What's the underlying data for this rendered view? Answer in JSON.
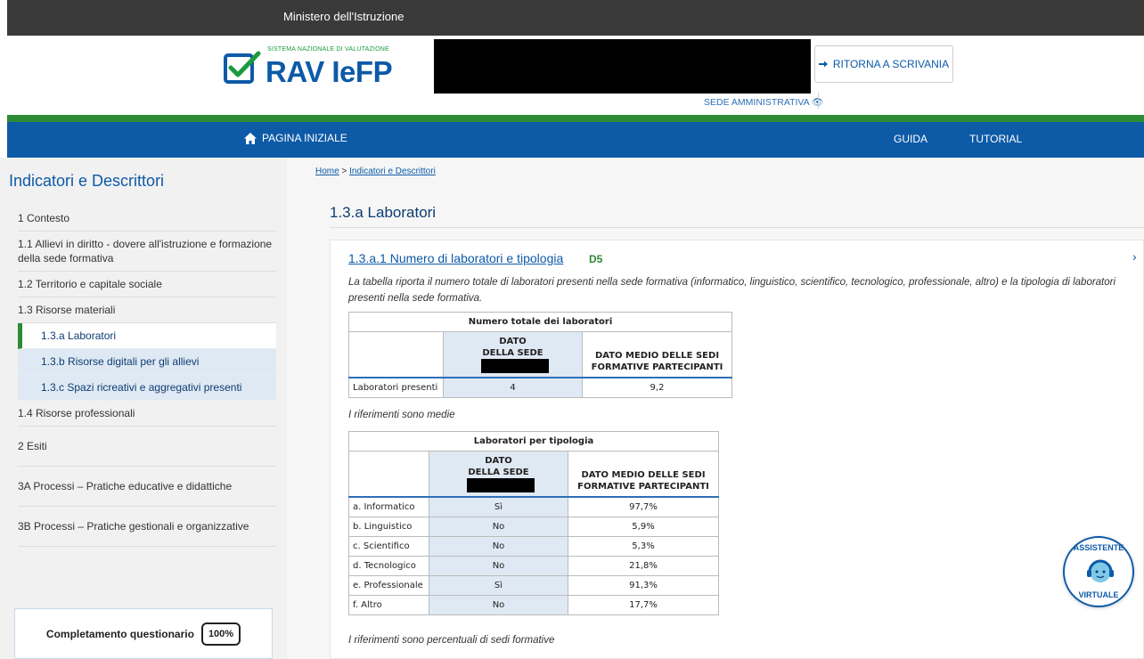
{
  "topbar": {
    "text": "Ministero dell'Istruzione"
  },
  "header": {
    "logo_sub": "SISTEMA NAZIONALE DI VALUTAZIONE",
    "logo_title": "RAV IeFP",
    "sede_link": "SEDE AMMINISTRATIVA",
    "scrivania_button": "RITORNA A SCRIVANIA"
  },
  "nav": {
    "home": "PAGINA INIZIALE",
    "guida": "GUIDA",
    "tutorial": "TUTORIAL"
  },
  "sidebar": {
    "title": "Indicatori e Descrittori",
    "items": [
      {
        "label": "1 Contesto"
      },
      {
        "label": "1.1 Allievi in diritto - dovere all'istruzione e formazione della sede formativa"
      },
      {
        "label": "1.2 Territorio e capitale sociale"
      },
      {
        "label": "1.3 Risorse materiali"
      },
      {
        "label": "1.3.a Laboratori"
      },
      {
        "label": "1.3.b Risorse digitali per gli allievi"
      },
      {
        "label": "1.3.c Spazi ricreativi e aggregativi presenti"
      },
      {
        "label": "1.4 Risorse professionali"
      },
      {
        "label": "2 Esiti"
      },
      {
        "label": "3A Processi – Pratiche educative e didattiche"
      },
      {
        "label": "3B Processi – Pratiche gestionali e organizzative"
      }
    ],
    "completamento_label": "Completamento questionario",
    "completamento_value": "100%"
  },
  "breadcrumb": {
    "home": "Home",
    "sep": ">",
    "current": "Indicatori e Descrittori"
  },
  "main": {
    "title": "1.3.a Laboratori",
    "card_title": "1.3.a.1 Numero di laboratori e tipologia",
    "card_badge": "D5",
    "card_description": "La tabella riporta il numero totale di laboratori presenti nella sede formativa (informatico, linguistico, scientifico, tecnologico, professionale, altro) e la tipologia di laboratori presenti nella sede formativa.",
    "table1": {
      "caption": "Numero totale dei laboratori",
      "col_sede_1": "DATO",
      "col_sede_2": "DELLA SEDE",
      "col_medio_1": "DATO MEDIO DELLE SEDI",
      "col_medio_2": "FORMATIVE PARTECIPANTI",
      "row_label": "Laboratori presenti",
      "row_sede": "4",
      "row_medio": "9,2"
    },
    "note1": "I riferimenti sono medie",
    "table2": {
      "caption": "Laboratori per tipologia",
      "col_sede_1": "DATO",
      "col_sede_2": "DELLA SEDE",
      "col_medio_1": "DATO MEDIO DELLE SEDI",
      "col_medio_2": "FORMATIVE PARTECIPANTI",
      "rows": [
        {
          "label": "a. Informatico",
          "sede": "Sì",
          "medio": "97,7%"
        },
        {
          "label": "b. Linguistico",
          "sede": "No",
          "medio": "5,9%"
        },
        {
          "label": "c. Scientifico",
          "sede": "No",
          "medio": "5,3%"
        },
        {
          "label": "d. Tecnologico",
          "sede": "No",
          "medio": "21,8%"
        },
        {
          "label": "e. Professionale",
          "sede": "Sì",
          "medio": "91,3%"
        },
        {
          "label": "f. Altro",
          "sede": "No",
          "medio": "17,7%"
        }
      ]
    },
    "note2": "I riferimenti sono percentuali di sedi formative"
  },
  "assistant": {
    "top": "ASSISTENTE",
    "bottom": "VIRTUALE"
  },
  "icons": {
    "home": "home-icon",
    "login": "sign-in-icon",
    "eye": "eye-icon",
    "chevron": "chevron-right-icon"
  },
  "colors": {
    "brand_blue": "#0d5aa7",
    "brand_green": "#2e8b35",
    "topbar": "#3a3a3a"
  }
}
